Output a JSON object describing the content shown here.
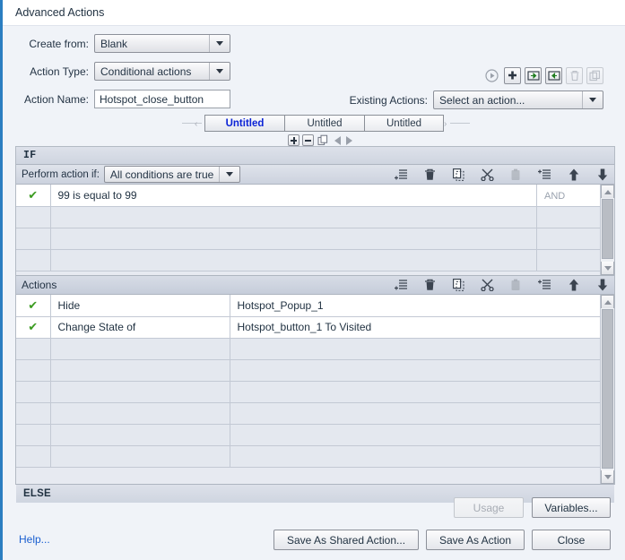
{
  "window": {
    "title": "Advanced Actions",
    "accent": "#2b7ec1"
  },
  "form": {
    "create_from": {
      "label": "Create from:",
      "value": "Blank"
    },
    "action_type": {
      "label": "Action Type:",
      "value": "Conditional actions"
    },
    "action_name": {
      "label": "Action Name:",
      "value": "Hotspot_close_button"
    },
    "existing_actions": {
      "label": "Existing Actions:",
      "value": "Select an action..."
    }
  },
  "header_icons": [
    {
      "name": "preview-icon",
      "glyph": "▶",
      "disabled": true
    },
    {
      "name": "add-action-icon",
      "glyph": "✚",
      "disabled": false
    },
    {
      "name": "export-action-icon",
      "glyph": "→",
      "disabled": false
    },
    {
      "name": "import-action-icon",
      "glyph": "←",
      "disabled": false
    },
    {
      "name": "delete-action-icon",
      "glyph": "🗑",
      "disabled": true
    },
    {
      "name": "duplicate-action-icon",
      "glyph": "⧉",
      "disabled": true
    }
  ],
  "tabs": [
    {
      "label": "Untitled",
      "active": true
    },
    {
      "label": "Untitled",
      "active": false
    },
    {
      "label": "Untitled",
      "active": false
    }
  ],
  "tab_controls": [
    {
      "name": "add-tab-button",
      "glyph": "+"
    },
    {
      "name": "remove-tab-button",
      "glyph": "-"
    },
    {
      "name": "duplicate-tab-button",
      "glyph": "⧉"
    },
    {
      "name": "previous-tab-button",
      "glyph": "◁"
    },
    {
      "name": "next-tab-button",
      "glyph": "▷"
    }
  ],
  "if_section": {
    "band_label": "IF",
    "perform_label": "Perform action if:",
    "perform_value": "All conditions are true",
    "operator_header": "AND",
    "conditions": [
      {
        "enabled": true,
        "expression": "99   is equal to   99",
        "operator": ""
      },
      {
        "enabled": false,
        "expression": "",
        "operator": ""
      },
      {
        "enabled": false,
        "expression": "",
        "operator": ""
      },
      {
        "enabled": false,
        "expression": "",
        "operator": ""
      }
    ]
  },
  "actions_section": {
    "band_label": "Actions",
    "rows": [
      {
        "enabled": true,
        "action": "Hide",
        "target": "Hotspot_Popup_1"
      },
      {
        "enabled": true,
        "action": "Change State of",
        "target": "Hotspot_button_1   To   Visited"
      },
      {
        "enabled": false,
        "action": "",
        "target": ""
      },
      {
        "enabled": false,
        "action": "",
        "target": ""
      },
      {
        "enabled": false,
        "action": "",
        "target": ""
      },
      {
        "enabled": false,
        "action": "",
        "target": ""
      },
      {
        "enabled": false,
        "action": "",
        "target": ""
      },
      {
        "enabled": false,
        "action": "",
        "target": ""
      }
    ]
  },
  "else_section": {
    "band_label": "ELSE"
  },
  "row_tools": [
    {
      "name": "add-row-icon",
      "glyph": "≡",
      "dim": false
    },
    {
      "name": "delete-row-icon",
      "glyph": "🗑",
      "dim": false
    },
    {
      "name": "copy-row-icon",
      "glyph": "⧉",
      "dim": false
    },
    {
      "name": "cut-row-icon",
      "glyph": "✂",
      "dim": false
    },
    {
      "name": "paste-row-icon",
      "glyph": "📋",
      "dim": true
    },
    {
      "name": "insert-row-icon",
      "glyph": "≣",
      "dim": false
    },
    {
      "name": "move-up-icon",
      "glyph": "⬆",
      "dim": false
    },
    {
      "name": "move-down-icon",
      "glyph": "⬇",
      "dim": false
    }
  ],
  "footer": {
    "help": "Help...",
    "usage": "Usage",
    "variables": "Variables...",
    "save_shared": "Save As Shared Action...",
    "save_action": "Save As Action",
    "close": "Close"
  },
  "checkmark": "✔"
}
